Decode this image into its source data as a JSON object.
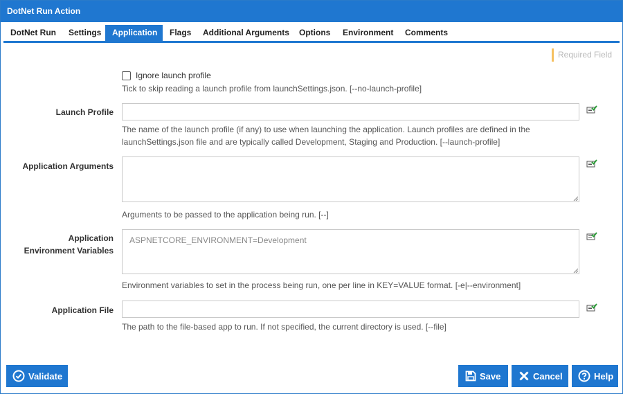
{
  "window": {
    "title": "DotNet Run Action"
  },
  "tabs": [
    {
      "label": "DotNet Run"
    },
    {
      "label": "Settings"
    },
    {
      "label": "Application"
    },
    {
      "label": "Flags"
    },
    {
      "label": "Additional Arguments"
    },
    {
      "label": "Options"
    },
    {
      "label": "Environment"
    },
    {
      "label": "Comments"
    }
  ],
  "active_tab": "Application",
  "required_legend": "Required Field",
  "form": {
    "ignore_launch_profile": {
      "label": "Ignore launch profile",
      "checked": false,
      "help": "Tick to skip reading a launch profile from launchSettings.json. [--no-launch-profile]"
    },
    "launch_profile": {
      "label": "Launch Profile",
      "value": "",
      "help_line1": "The name of the launch profile (if any) to use when launching the application. Launch profiles are defined in the",
      "help_line2": "launchSettings.json file and are typically called Development, Staging and Production. [--launch-profile]"
    },
    "application_arguments": {
      "label": "Application Arguments",
      "value": "",
      "help": "Arguments to be passed to the application being run. [--]"
    },
    "application_environment_variables": {
      "label_line1": "Application",
      "label_line2": "Environment Variables",
      "value": "",
      "placeholder": "ASPNETCORE_ENVIRONMENT=Development",
      "help": "Environment variables to set in the process being run, one per line in KEY=VALUE format. [-e|--environment]"
    },
    "application_file": {
      "label": "Application File",
      "value": "",
      "help": "The path to the file-based app to run. If not specified, the current directory is used. [--file]"
    }
  },
  "buttons": {
    "validate": "Validate",
    "save": "Save",
    "cancel": "Cancel",
    "help": "Help"
  },
  "colors": {
    "primary": "#1f77d0",
    "required_marker": "#f5c060",
    "variable_icon": "#2e9e3a"
  },
  "icons": {
    "field_variable": "variable-insert-icon",
    "validate": "check-circle-icon",
    "save": "floppy-disk-icon",
    "cancel": "x-icon",
    "help": "question-circle-icon"
  }
}
